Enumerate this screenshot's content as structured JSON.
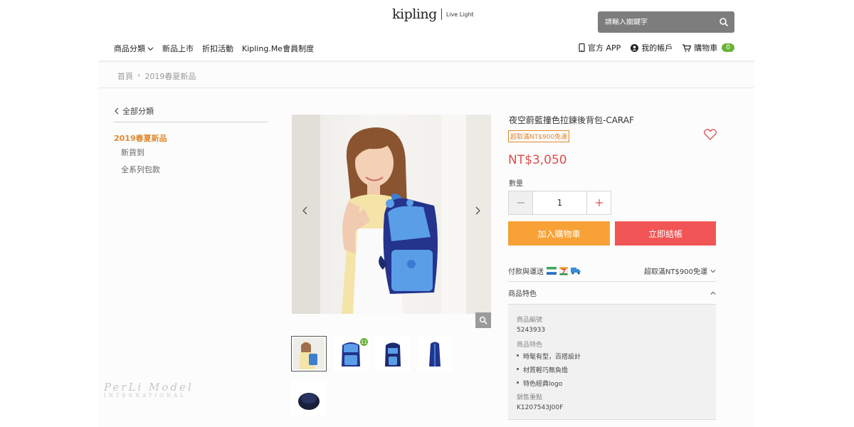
{
  "header": {
    "logo_word": "kipling",
    "logo_tagline": "Live Light",
    "search_placeholder": "請輸入關鍵字",
    "nav": [
      "商品分類",
      "新品上市",
      "折扣活動",
      "Kipling.Me會員制度"
    ],
    "util": {
      "app": "官方 APP",
      "account": "我的帳戶",
      "cart": "購物車",
      "cart_count": "0"
    }
  },
  "breadcrumb": {
    "home": "首頁",
    "separator": "›",
    "current": "2019春夏新品"
  },
  "sidebar": {
    "back_label": "全部分類",
    "active_category": "2019春夏新品",
    "items": [
      "新貨到",
      "全系列包款"
    ]
  },
  "watermark": {
    "main": "PerLi Model",
    "sub": "INTERNATIONAL"
  },
  "gallery": {
    "thumb_badge": "11"
  },
  "product": {
    "title": "夜空蔚藍撞色拉鍊後背包-CARAF",
    "shipping_badge": "超取滿NT$900免運",
    "price": "NT$3,050",
    "qty_label": "數量",
    "qty_value": "1",
    "add_to_cart": "加入購物車",
    "buy_now": "立即結帳",
    "payment_label": "付款與運送",
    "payment_note": "超取滿NT$900免運",
    "features_label": "商品特色"
  },
  "details": {
    "sku_label": "商品編號",
    "sku": "5243933",
    "features_label": "商品特色",
    "features": [
      "時髦有型，百搭設計",
      "材質輕巧無負擔",
      "特色經典logo"
    ],
    "selling_label": "銷售重點",
    "selling": "K1207543J00F"
  },
  "colors": {
    "accent_orange": "#f7a137",
    "buy_red": "#f15555",
    "price_red": "#e24c4c",
    "active_cat": "#e0892e",
    "badge_green": "#6bb33a"
  }
}
